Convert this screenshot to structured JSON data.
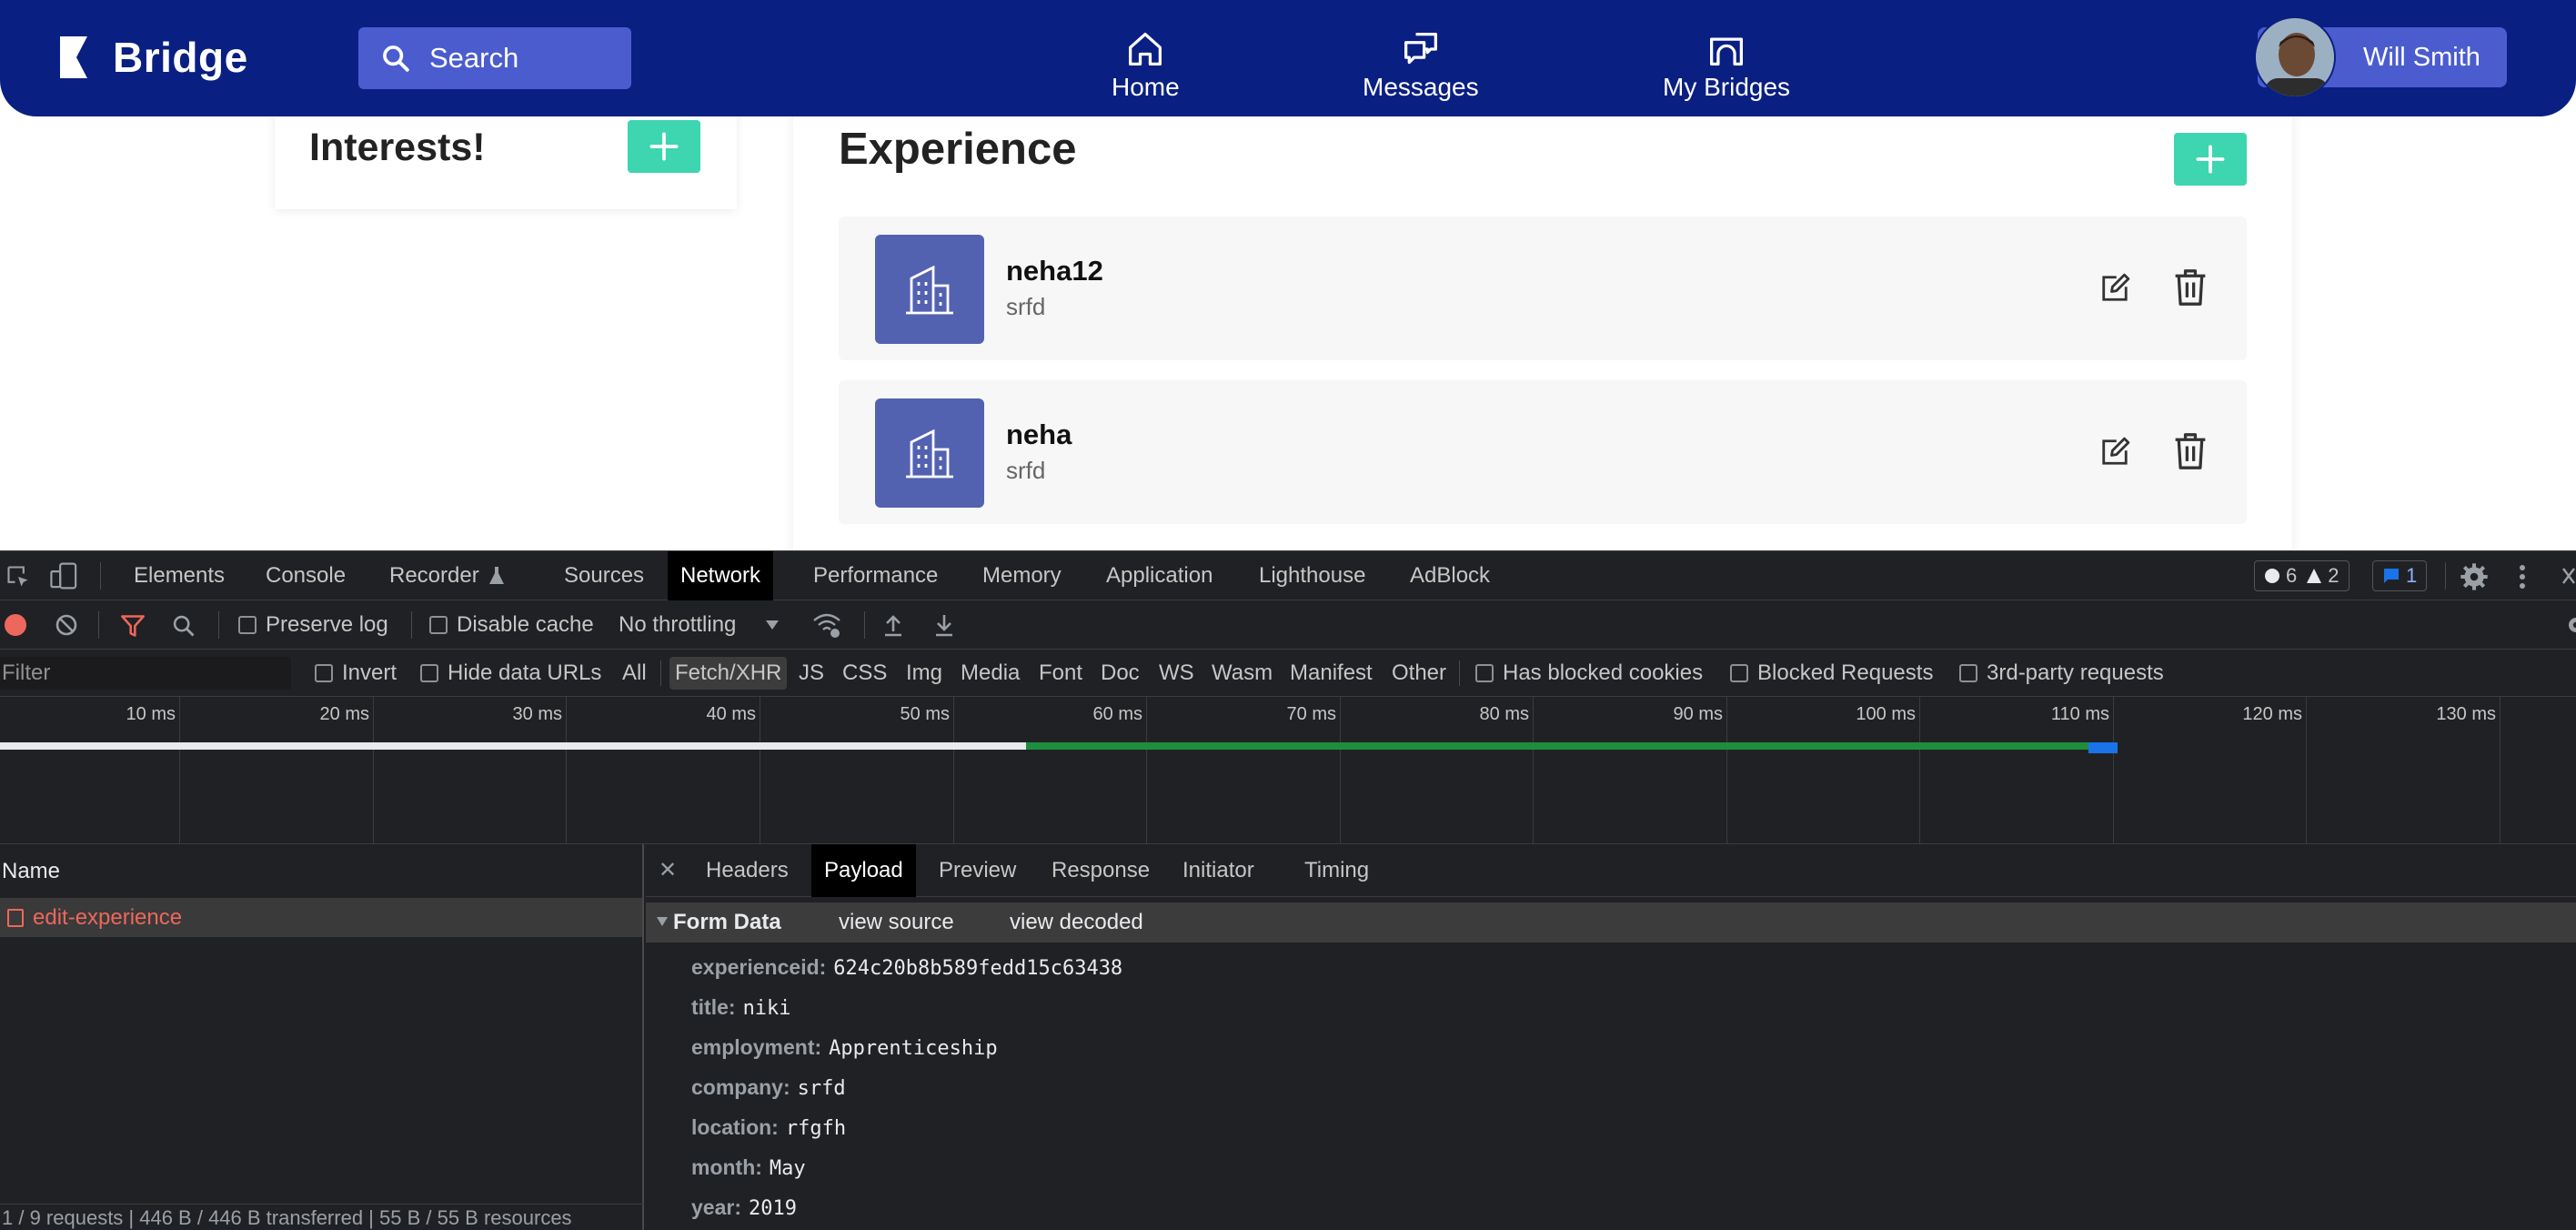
{
  "app": {
    "logo_text": "Bridge",
    "brand_color": "#0a1f82",
    "accent_color": "#3dd6b0"
  },
  "nav": {
    "search_label": "Search",
    "items": [
      {
        "label": "Home",
        "icon": "home-icon"
      },
      {
        "label": "Messages",
        "icon": "messages-icon"
      },
      {
        "label": "My Bridges",
        "icon": "bridge-icon"
      }
    ],
    "user_name": "Will Smith"
  },
  "interests": {
    "title": "Interests!"
  },
  "experience": {
    "title": "Experience",
    "items": [
      {
        "name": "neha12",
        "company": "srfd"
      },
      {
        "name": "neha",
        "company": "srfd"
      }
    ]
  },
  "devtools": {
    "tabs": [
      "Elements",
      "Console",
      "Recorder",
      "Sources",
      "Network",
      "Performance",
      "Memory",
      "Application",
      "Lighthouse",
      "AdBlock"
    ],
    "active_tab": "Network",
    "badges": {
      "issues": "6",
      "warnings": "2",
      "messages": "1"
    },
    "toolbar": {
      "preserve_log": "Preserve log",
      "disable_cache": "Disable cache",
      "throttling": "No throttling"
    },
    "filter": {
      "placeholder": "Filter",
      "invert": "Invert",
      "hide_data_urls": "Hide data URLs",
      "types": [
        "All",
        "Fetch/XHR",
        "JS",
        "CSS",
        "Img",
        "Media",
        "Font",
        "Doc",
        "WS",
        "Wasm",
        "Manifest",
        "Other"
      ],
      "selected_type": "Fetch/XHR",
      "has_blocked_cookies": "Has blocked cookies",
      "blocked_requests": "Blocked Requests",
      "third_party": "3rd-party requests"
    },
    "timeline_ticks": [
      "10 ms",
      "20 ms",
      "30 ms",
      "40 ms",
      "50 ms",
      "60 ms",
      "70 ms",
      "80 ms",
      "90 ms",
      "100 ms",
      "110 ms",
      "120 ms",
      "130 ms"
    ],
    "name_header": "Name",
    "requests": [
      {
        "name": "edit-experience"
      }
    ],
    "status_bar": "1 / 9 requests  |  446 B / 446 B transferred  |  55 B / 55 B resources",
    "detail_tabs": [
      "Headers",
      "Payload",
      "Preview",
      "Response",
      "Initiator",
      "Timing"
    ],
    "active_detail_tab": "Payload",
    "form_data": {
      "title": "Form Data",
      "view_source": "view source",
      "view_decoded": "view decoded",
      "fields": [
        {
          "key": "experienceid:",
          "value": "624c20b8b589fedd15c63438"
        },
        {
          "key": "title:",
          "value": "niki"
        },
        {
          "key": "employment:",
          "value": "Apprenticeship"
        },
        {
          "key": "company:",
          "value": "srfd"
        },
        {
          "key": "location:",
          "value": "rfgfh"
        },
        {
          "key": "month:",
          "value": "May"
        },
        {
          "key": "year:",
          "value": "2019"
        }
      ]
    }
  }
}
